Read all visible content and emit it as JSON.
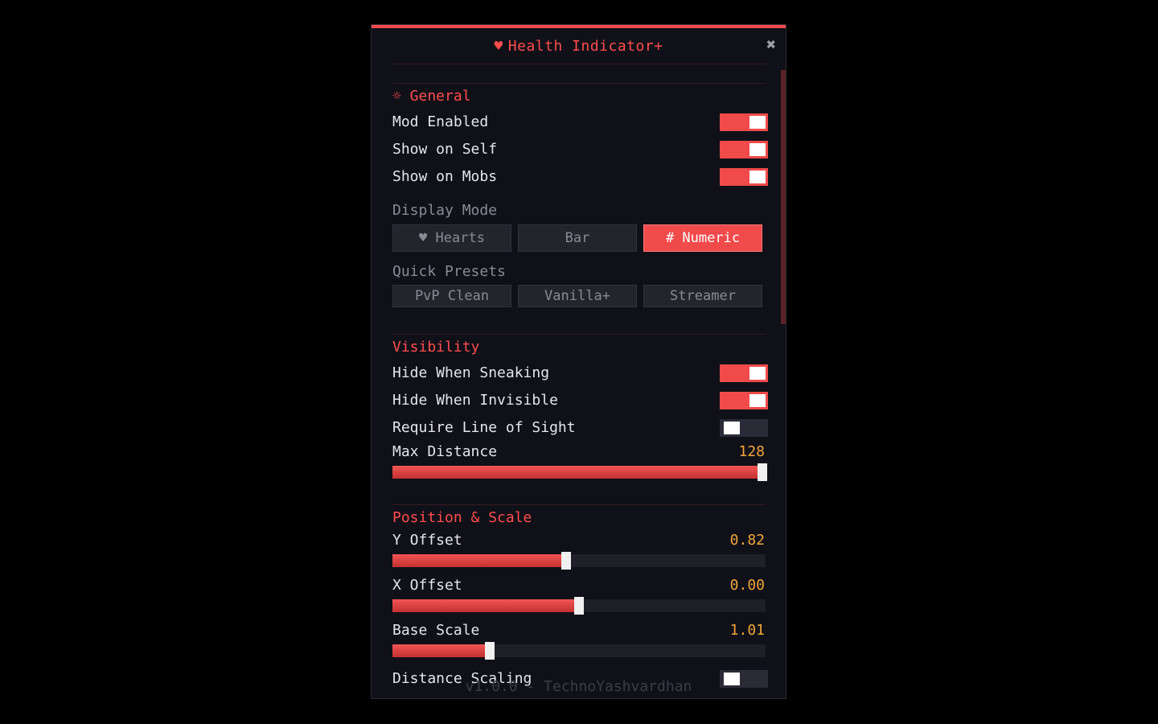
{
  "window": {
    "title_icon": "heart-icon",
    "title": "Health Indicator+",
    "close_icon": "close-icon"
  },
  "colors": {
    "accent": "#f04a4a",
    "panel_bg": "#0f1018",
    "value": "#f2a53a"
  },
  "general": {
    "title": "☼ General",
    "mod_enabled": {
      "label": "Mod Enabled",
      "on": true
    },
    "show_on_self": {
      "label": "Show on Self",
      "on": true
    },
    "show_on_mobs": {
      "label": "Show on Mobs",
      "on": true
    },
    "display_mode": {
      "label": "Display Mode",
      "options": [
        "♥ Hearts",
        "Bar",
        "# Numeric"
      ],
      "selected": "# Numeric"
    },
    "quick_presets": {
      "label": "Quick Presets",
      "options": [
        "PvP Clean",
        "Vanilla+",
        "Streamer"
      ]
    }
  },
  "visibility": {
    "title": "Visibility",
    "hide_sneaking": {
      "label": "Hide When Sneaking",
      "on": true
    },
    "hide_invisible": {
      "label": "Hide When Invisible",
      "on": true
    },
    "line_of_sight": {
      "label": "Require Line of Sight",
      "on": false
    },
    "max_distance": {
      "label": "Max Distance",
      "value": "128",
      "fraction": 1.0
    }
  },
  "position": {
    "title": "Position & Scale",
    "y_offset": {
      "label": "Y Offset",
      "value": "0.82",
      "fraction": 0.465
    },
    "x_offset": {
      "label": "X Offset",
      "value": "0.00",
      "fraction": 0.5
    },
    "base_scale": {
      "label": "Base Scale",
      "value": "1.01",
      "fraction": 0.26
    },
    "distance_scaling": {
      "label": "Distance Scaling",
      "on": false
    }
  },
  "footer": {
    "text": "v1.0.0 - TechnoYashvardhan"
  }
}
